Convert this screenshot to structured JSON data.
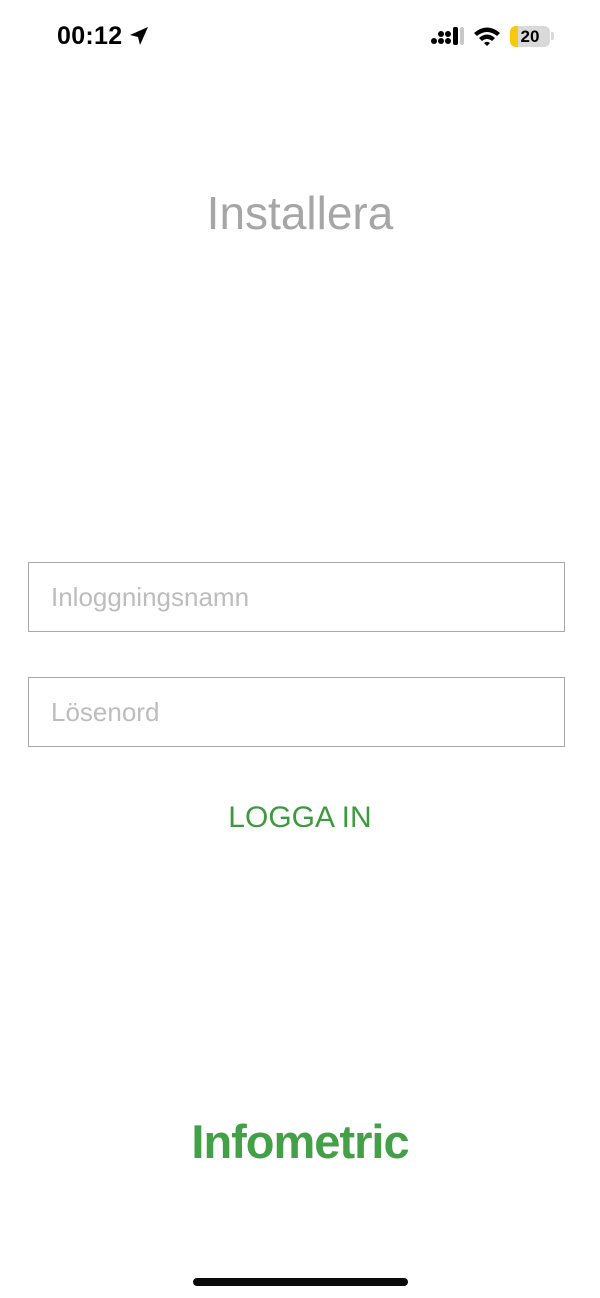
{
  "status_bar": {
    "time": "00:12",
    "battery_level": "20",
    "battery_fraction": 0.2,
    "battery_color": "#f7c90a",
    "icons": [
      "location-arrow-icon",
      "cellular-signal-icon",
      "wifi-icon",
      "battery-icon"
    ]
  },
  "header": {
    "title": "Installera"
  },
  "login_form": {
    "username_placeholder": "Inloggningsnamn",
    "username_value": "",
    "password_placeholder": "Lösenord",
    "password_value": "",
    "submit_label": "LOGGA IN"
  },
  "footer": {
    "brand": "Infometric"
  },
  "colors": {
    "accent": "#3f9a3f",
    "brand": "#43a047",
    "title": "#a6a6a6",
    "field_border": "#a9a9a9"
  }
}
